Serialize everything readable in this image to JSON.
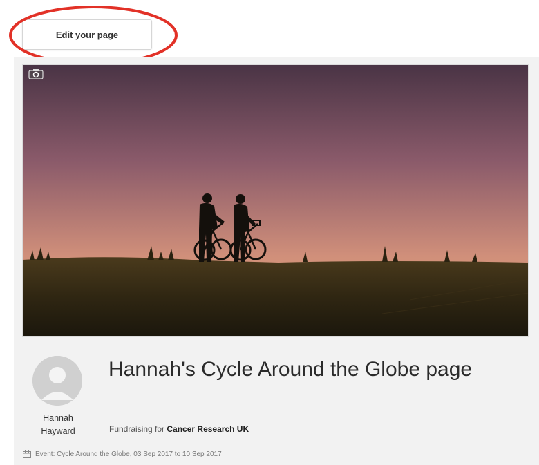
{
  "toolbar": {
    "edit_label": "Edit your page"
  },
  "page": {
    "title": "Hannah's Cycle Around the Globe page",
    "owner": {
      "first_name": "Hannah",
      "last_name": "Hayward"
    },
    "fundraising_prefix": "Fundraising for",
    "charity": "Cancer Research UK",
    "event_text": "Event: Cycle Around the Globe, 03 Sep 2017 to 10 Sep 2017"
  },
  "icons": {
    "camera": "camera-icon",
    "calendar": "calendar-icon",
    "avatar": "user-placeholder"
  },
  "colors": {
    "highlight": "#e23127",
    "card_background": "#f2f2f2",
    "sky_top": "#4a3445",
    "sky_bottom": "#e3a57c"
  }
}
